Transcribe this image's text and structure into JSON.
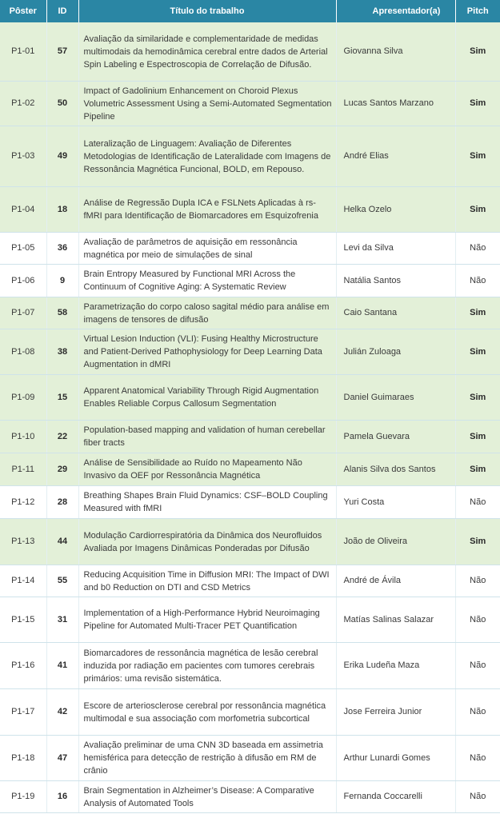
{
  "columns": {
    "poster": "Pôster",
    "id": "ID",
    "title": "Título do trabalho",
    "presenter": "Apresentador(a)",
    "pitch": "Pitch"
  },
  "colors": {
    "header_bg": "#2a86a4",
    "highlight_row": "#e3f0d8"
  },
  "rows": [
    {
      "poster": "P1-01",
      "id": "57",
      "title": "Avaliação da similaridade e complementaridade de medidas multimodais da hemodinâmica cerebral entre dados de Arterial Spin Labeling e Espectroscopia de Correlação de Difusão.",
      "presenter": "Giovanna Silva",
      "pitch": "Sim"
    },
    {
      "poster": "P1-02",
      "id": "50",
      "title": "Impact of Gadolinium Enhancement on Choroid Plexus Volumetric Assessment Using a Semi-Automated Segmentation Pipeline",
      "presenter": "Lucas Santos Marzano",
      "pitch": "Sim"
    },
    {
      "poster": "P1-03",
      "id": "49",
      "title": "Lateralização de Linguagem: Avaliação de Diferentes Metodologias de Identificação de Lateralidade com Imagens de Ressonância Magnética Funcional, BOLD, em Repouso.",
      "presenter": "André Elias",
      "pitch": "Sim"
    },
    {
      "poster": "P1-04",
      "id": "18",
      "title": "Análise de Regressão Dupla ICA e FSLNets Aplicadas à rs-fMRI para Identificação de Biomarcadores em Esquizofrenia",
      "presenter": "Helka Ozelo",
      "pitch": "Sim"
    },
    {
      "poster": "P1-05",
      "id": "36",
      "title": "Avaliação de parâmetros de aquisição em ressonância magnética por meio de simulações de sinal",
      "presenter": "Levi da Silva",
      "pitch": "Não"
    },
    {
      "poster": "P1-06",
      "id": "9",
      "title": "Brain Entropy Measured by Functional MRI Across the Continuum of Cognitive Aging: A Systematic Review",
      "presenter": "Natália Santos",
      "pitch": "Não"
    },
    {
      "poster": "P1-07",
      "id": "58",
      "title": "Parametrização do corpo caloso sagital médio para análise em imagens de tensores de difusão",
      "presenter": "Caio Santana",
      "pitch": "Sim"
    },
    {
      "poster": "P1-08",
      "id": "38",
      "title": "Virtual Lesion Induction (VLI): Fusing Healthy Microstructure and Patient-Derived Pathophysiology for Deep Learning Data Augmentation in dMRI",
      "presenter": "Julián Zuloaga",
      "pitch": "Sim"
    },
    {
      "poster": "P1-09",
      "id": "15",
      "title": "Apparent Anatomical Variability Through Rigid Augmentation Enables Reliable Corpus Callosum Segmentation",
      "presenter": "Daniel Guimaraes",
      "pitch": "Sim"
    },
    {
      "poster": "P1-10",
      "id": "22",
      "title": "Population-based mapping and validation of human cerebellar fiber tracts",
      "presenter": "Pamela Guevara",
      "pitch": "Sim"
    },
    {
      "poster": "P1-11",
      "id": "29",
      "title": "Análise de Sensibilidade ao Ruído no Mapeamento Não Invasivo da OEF por Ressonância Magnética",
      "presenter": "Alanis Silva dos Santos",
      "pitch": "Sim"
    },
    {
      "poster": "P1-12",
      "id": "28",
      "title": "Breathing Shapes Brain Fluid Dynamics: CSF–BOLD Coupling Measured with fMRI",
      "presenter": "Yuri Costa",
      "pitch": "Não"
    },
    {
      "poster": "P1-13",
      "id": "44",
      "title": "Modulação Cardiorrespiratória da Dinâmica dos Neurofluidos Avaliada por Imagens Dinâmicas Ponderadas por Difusão",
      "presenter": "João de Oliveira",
      "pitch": "Sim"
    },
    {
      "poster": "P1-14",
      "id": "55",
      "title": "Reducing Acquisition Time in Diffusion MRI: The Impact of DWI and b0 Reduction on DTI and CSD Metrics",
      "presenter": "André de Ávila",
      "pitch": "Não"
    },
    {
      "poster": "P1-15",
      "id": "31",
      "title": "Implementation of a High-Performance Hybrid Neuroimaging Pipeline for Automated Multi-Tracer PET Quantification",
      "presenter": "Matías Salinas Salazar",
      "pitch": "Não"
    },
    {
      "poster": "P1-16",
      "id": "41",
      "title": "Biomarcadores de ressonância magnética de lesão cerebral induzida por radiação em pacientes com tumores cerebrais primários: uma revisão sistemática.",
      "presenter": "Erika Ludeña Maza",
      "pitch": "Não"
    },
    {
      "poster": "P1-17",
      "id": "42",
      "title": "Escore de arteriosclerose cerebral por ressonância magnética multimodal e sua associação com morfometria subcortical",
      "presenter": "Jose Ferreira Junior",
      "pitch": "Não"
    },
    {
      "poster": "P1-18",
      "id": "47",
      "title": "Avaliação preliminar de uma CNN 3D baseada em assimetria hemisférica para detecção de restrição à difusão em RM de crânio",
      "presenter": "Arthur Lunardi Gomes",
      "pitch": "Não"
    },
    {
      "poster": "P1-19",
      "id": "16",
      "title": "Brain Segmentation in Alzheimer’s Disease: A Comparative Analysis of Automated Tools",
      "presenter": "Fernanda Coccarelli",
      "pitch": "Não"
    }
  ]
}
